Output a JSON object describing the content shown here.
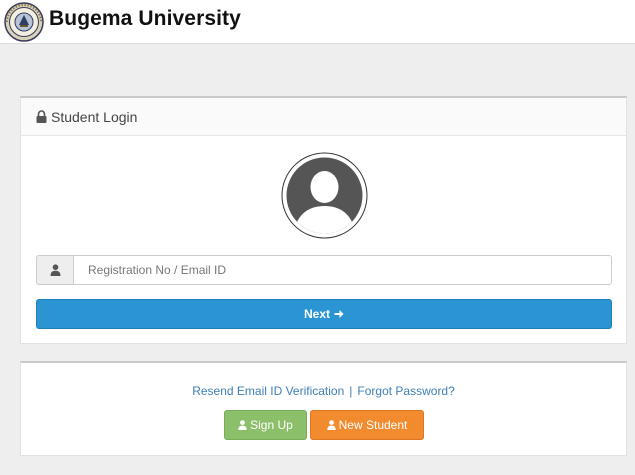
{
  "header": {
    "brand": "Bugema University",
    "logo_icon": "university-seal-icon"
  },
  "login": {
    "title": "Student Login",
    "lock_icon": "lock-icon",
    "avatar_icon": "user-avatar-icon",
    "input": {
      "placeholder": "Registration No / Email ID",
      "value": "",
      "addon_icon": "user-icon"
    },
    "next_label": "Next",
    "next_icon": "arrow-right-icon"
  },
  "links": {
    "resend_label": "Resend Email ID Verification",
    "separator": "|",
    "forgot_label": "Forgot Password?",
    "signup_label": "Sign Up",
    "new_student_label": "New Student"
  },
  "colors": {
    "primary": "#2b95d3",
    "success": "#8cbf69",
    "warning": "#f28a2e",
    "link": "#3f7fb6"
  }
}
